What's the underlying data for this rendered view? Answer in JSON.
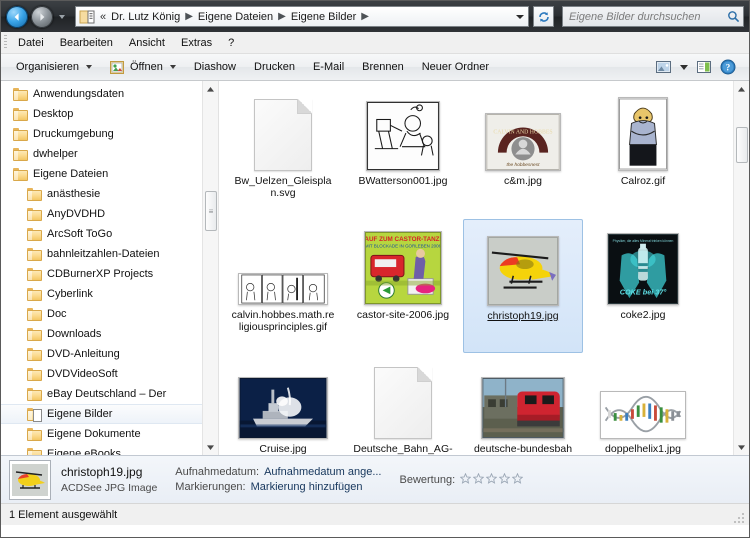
{
  "window": {
    "address": {
      "double_chevron": "«",
      "crumbs": [
        "Dr. Lutz König",
        "Eigene Dateien",
        "Eigene Bilder"
      ],
      "separator": "▶"
    },
    "search": {
      "placeholder": "Eigene Bilder durchsuchen",
      "icon": "search-icon"
    },
    "back_icon": "back-arrow-icon",
    "forward_icon": "forward-arrow-icon",
    "recent_pages_icon": "chevron-down-icon",
    "refresh_icon": "refresh-icon"
  },
  "menubar": {
    "items": [
      "Datei",
      "Bearbeiten",
      "Ansicht",
      "Extras",
      "?"
    ]
  },
  "toolbar": {
    "organize_label": "Organisieren",
    "open_label": "Öffnen",
    "items": [
      "Diashow",
      "Drucken",
      "E-Mail",
      "Brennen",
      "Neuer Ordner"
    ],
    "view_icon": "view-mode-icon",
    "view_dropdown_icon": "chevron-down-icon",
    "preview_pane_icon": "preview-pane-icon",
    "help_icon": "help-icon"
  },
  "sidebar": {
    "items": [
      {
        "label": "Anwendungsdaten",
        "indent": 0,
        "selected": false,
        "icon": "folder-icon"
      },
      {
        "label": "Desktop",
        "indent": 0,
        "selected": false,
        "icon": "folder-icon"
      },
      {
        "label": "Druckumgebung",
        "indent": 0,
        "selected": false,
        "icon": "folder-icon"
      },
      {
        "label": "dwhelper",
        "indent": 0,
        "selected": false,
        "icon": "folder-icon"
      },
      {
        "label": "Eigene Dateien",
        "indent": 0,
        "selected": false,
        "icon": "folder-icon"
      },
      {
        "label": "anästhesie",
        "indent": 1,
        "selected": false,
        "icon": "folder-icon"
      },
      {
        "label": "AnyDVDHD",
        "indent": 1,
        "selected": false,
        "icon": "folder-icon"
      },
      {
        "label": "ArcSoft ToGo",
        "indent": 1,
        "selected": false,
        "icon": "folder-icon"
      },
      {
        "label": "bahnleitzahlen-Dateien",
        "indent": 1,
        "selected": false,
        "icon": "folder-icon"
      },
      {
        "label": "CDBurnerXP Projects",
        "indent": 1,
        "selected": false,
        "icon": "folder-icon"
      },
      {
        "label": "Cyberlink",
        "indent": 1,
        "selected": false,
        "icon": "folder-icon"
      },
      {
        "label": "Doc",
        "indent": 1,
        "selected": false,
        "icon": "folder-icon"
      },
      {
        "label": "Downloads",
        "indent": 1,
        "selected": false,
        "icon": "folder-icon"
      },
      {
        "label": "DVD-Anleitung",
        "indent": 1,
        "selected": false,
        "icon": "folder-icon"
      },
      {
        "label": "DVDVideoSoft",
        "indent": 1,
        "selected": false,
        "icon": "folder-icon"
      },
      {
        "label": "eBay Deutschland – Der",
        "indent": 1,
        "selected": false,
        "icon": "folder-icon"
      },
      {
        "label": "Eigene Bilder",
        "indent": 1,
        "selected": true,
        "icon": "pictures-folder-icon"
      },
      {
        "label": "Eigene Dokumente",
        "indent": 1,
        "selected": false,
        "icon": "folder-icon"
      },
      {
        "label": "Eigene eBooks",
        "indent": 1,
        "selected": false,
        "icon": "folder-icon"
      }
    ],
    "scroll_up_icon": "scroll-up-icon",
    "scroll_down_icon": "scroll-down-icon"
  },
  "files": [
    {
      "name": "Bw_Uelzen_Gleisplan.svg",
      "kind": "doc",
      "selected": false
    },
    {
      "name": "BWatterson001.jpg",
      "kind": "photo-watterson",
      "selected": false
    },
    {
      "name": "c&m.jpg",
      "kind": "photo-cm",
      "selected": false
    },
    {
      "name": "Calroz.gif",
      "kind": "photo-calroz",
      "selected": false
    },
    {
      "name": "calvin.hobbes.math.religiousprinciples.gif",
      "kind": "photo-calvin-strip",
      "selected": false
    },
    {
      "name": "castor-site-2006.jpg",
      "kind": "photo-castor",
      "selected": false
    },
    {
      "name": "christoph19.jpg",
      "kind": "photo-heli",
      "selected": true
    },
    {
      "name": "coke2.jpg",
      "kind": "photo-coke",
      "selected": false
    },
    {
      "name": "Cruise.jpg",
      "kind": "photo-cruise",
      "selected": false
    },
    {
      "name": "Deutsche_Bahn_AG-Logo.svg",
      "kind": "doc",
      "selected": false
    },
    {
      "name": "deutsche-bundesbahn.jpg",
      "kind": "photo-train",
      "selected": false
    },
    {
      "name": "doppelhelix1.jpg",
      "kind": "photo-helix",
      "selected": false
    }
  ],
  "details": {
    "file_name": "christoph19.jpg",
    "file_type": "ACDSee JPG Image",
    "date_key": "Aufnahmedatum:",
    "date_value": "Aufnahmedatum ange...",
    "tags_key": "Markierungen:",
    "tags_value": "Markierung hinzufügen",
    "rating_key": "Bewertung:",
    "rating_stars": 5,
    "rating_filled": 0
  },
  "statusbar": {
    "text": "1 Element ausgewählt"
  }
}
